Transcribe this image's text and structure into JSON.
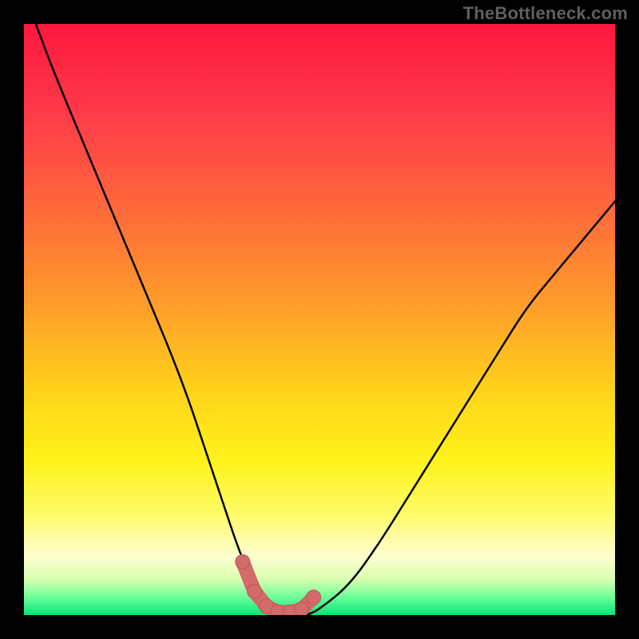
{
  "watermark": "TheBottleneck.com",
  "colors": {
    "frame": "#000000",
    "gradient_stops": [
      {
        "offset": 0.0,
        "color": "#ff173e"
      },
      {
        "offset": 0.15,
        "color": "#ff3a4a"
      },
      {
        "offset": 0.32,
        "color": "#ff6b3a"
      },
      {
        "offset": 0.48,
        "color": "#ff9f2a"
      },
      {
        "offset": 0.62,
        "color": "#ffd21a"
      },
      {
        "offset": 0.74,
        "color": "#fff31a"
      },
      {
        "offset": 0.83,
        "color": "#fffb6a"
      },
      {
        "offset": 0.9,
        "color": "#ffffd0"
      },
      {
        "offset": 0.94,
        "color": "#d7ffb0"
      },
      {
        "offset": 0.97,
        "color": "#6cff9a"
      },
      {
        "offset": 1.0,
        "color": "#00e77a"
      }
    ],
    "curve": "#000000",
    "marker_fill": "#d46a6a",
    "marker_stroke": "#c05555"
  },
  "chart_data": {
    "type": "line",
    "title": "",
    "xlabel": "",
    "ylabel": "",
    "xlim": [
      0,
      100
    ],
    "ylim": [
      0,
      100
    ],
    "grid": false,
    "series": [
      {
        "name": "bottleneck-curve",
        "x": [
          2,
          5,
          10,
          15,
          20,
          25,
          28,
          30,
          32,
          34,
          36,
          38,
          40,
          42,
          44,
          46,
          48,
          50,
          55,
          60,
          65,
          70,
          75,
          80,
          85,
          90,
          95,
          100
        ],
        "values": [
          100,
          92,
          80,
          68,
          56,
          44,
          36,
          30,
          24,
          18,
          12,
          7,
          3,
          1,
          0,
          0,
          0,
          1,
          5,
          12,
          20,
          28,
          36,
          44,
          52,
          58,
          64,
          70
        ]
      }
    ],
    "markers": {
      "name": "highlight-band",
      "x": [
        37,
        39,
        41,
        43,
        45,
        47,
        49
      ],
      "values": [
        9,
        4,
        1.5,
        0.5,
        0.5,
        1,
        3
      ]
    }
  }
}
